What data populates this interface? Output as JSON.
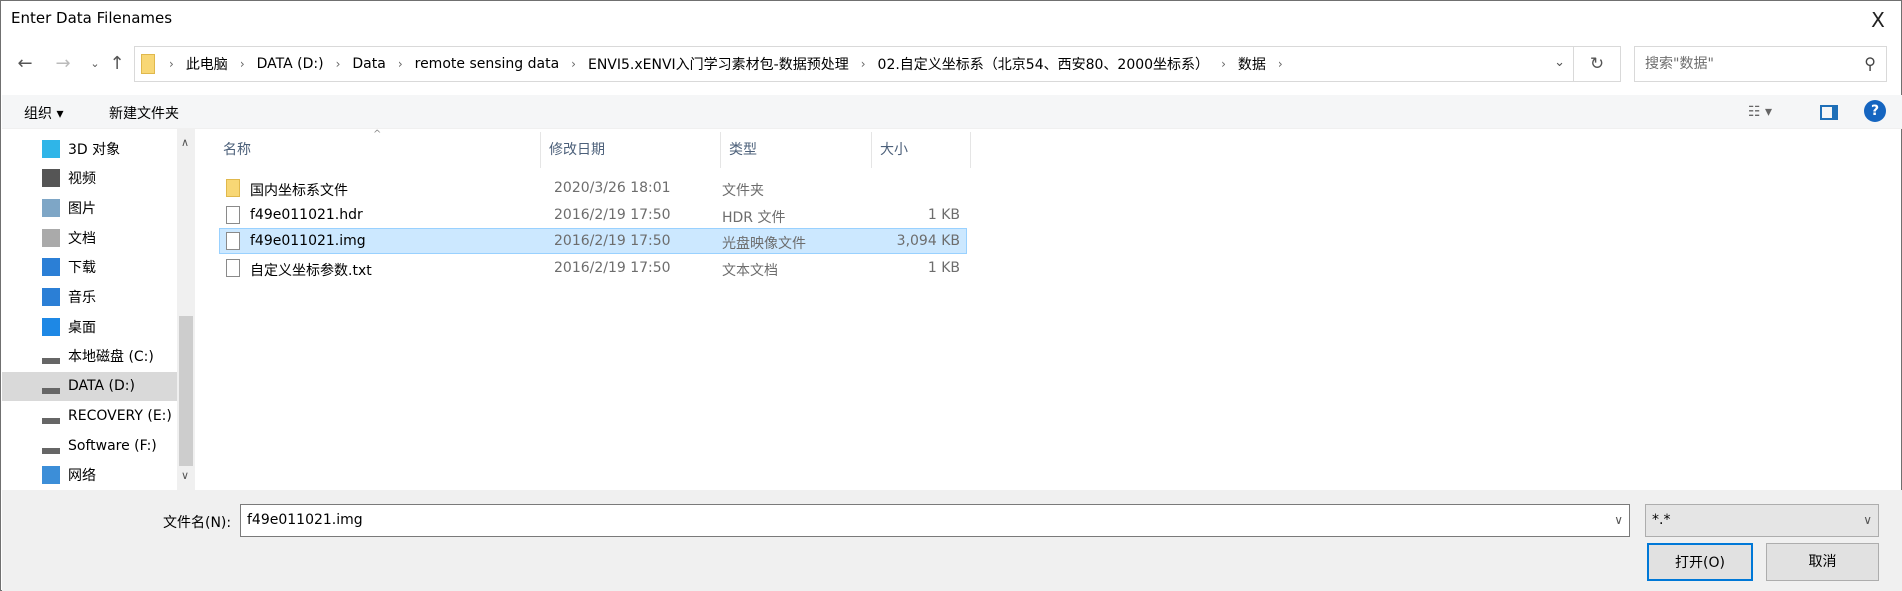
{
  "window": {
    "title": "Enter Data Filenames",
    "close": "X"
  },
  "address": {
    "crumbs": [
      "此电脑",
      "DATA (D:)",
      "Data",
      "remote sensing data",
      "ENVI5.xENVI入门学习素材包-数据预处理",
      "02.自定义坐标系（北京54、西安80、2000坐标系）",
      "数据"
    ]
  },
  "search": {
    "placeholder": "搜索\"数据\""
  },
  "toolbar": {
    "organize": "组织 ▾",
    "new_folder": "新建文件夹"
  },
  "nav": [
    {
      "label": "3D 对象",
      "icon": "3d-objects-icon",
      "color": "#2fb5e8"
    },
    {
      "label": "视频",
      "icon": "video-icon",
      "color": "#555"
    },
    {
      "label": "图片",
      "icon": "pictures-icon",
      "color": "#7ea6c6"
    },
    {
      "label": "文档",
      "icon": "documents-icon",
      "color": "#aaa"
    },
    {
      "label": "下载",
      "icon": "download-icon",
      "color": "#2b7fd6"
    },
    {
      "label": "音乐",
      "icon": "music-icon",
      "color": "#2b7fd6"
    },
    {
      "label": "桌面",
      "icon": "desktop-icon",
      "color": "#1e88e5"
    },
    {
      "label": "本地磁盘 (C:)",
      "icon": "drive-icon",
      "color": "#666"
    },
    {
      "label": "DATA (D:)",
      "icon": "drive-icon",
      "color": "#666",
      "selected": true
    },
    {
      "label": "RECOVERY (E:)",
      "icon": "drive-icon",
      "color": "#666"
    },
    {
      "label": "Software (F:)",
      "icon": "drive-icon",
      "color": "#666"
    },
    {
      "label": "网络",
      "icon": "network-icon",
      "color": "#3c8ed8"
    }
  ],
  "columns": [
    "名称",
    "修改日期",
    "类型",
    "大小"
  ],
  "files": [
    {
      "name": "国内坐标系文件",
      "date": "2020/3/26 18:01",
      "type": "文件夹",
      "size": "",
      "icon": "folder-icon"
    },
    {
      "name": "f49e011021.hdr",
      "date": "2016/2/19 17:50",
      "type": "HDR 文件",
      "size": "1 KB",
      "icon": "file-icon"
    },
    {
      "name": "f49e011021.img",
      "date": "2016/2/19 17:50",
      "type": "光盘映像文件",
      "size": "3,094 KB",
      "icon": "disc-image-icon",
      "selected": true
    },
    {
      "name": "自定义坐标参数.txt",
      "date": "2016/2/19 17:50",
      "type": "文本文档",
      "size": "1 KB",
      "icon": "text-file-icon"
    }
  ],
  "footer": {
    "filename_label": "文件名(N):",
    "filename_value": "f49e011021.img",
    "filter": "*.*",
    "open": "打开(O)",
    "cancel": "取消"
  }
}
